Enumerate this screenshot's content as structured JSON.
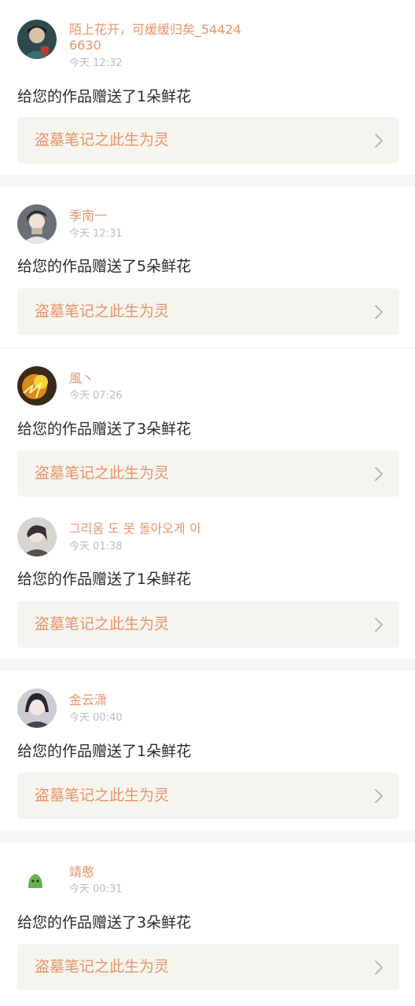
{
  "notifications": [
    {
      "avatar_icon": "avatar-photo-icon",
      "username": "陌上花开，可缓缓归矣_544246630",
      "time": "今天 12:32",
      "message": "给您的作品赠送了1朵鲜花",
      "work_title": "盗墓笔记之此生为灵"
    },
    {
      "avatar_icon": "avatar-photo-icon",
      "username": "季南一",
      "time": "今天 12:31",
      "message": "给您的作品赠送了5朵鲜花",
      "work_title": "盗墓笔记之此生为灵"
    },
    {
      "avatar_icon": "avatar-photo-icon",
      "username": "風丶",
      "time": "今天 07:26",
      "message": "给您的作品赠送了3朵鲜花",
      "work_title": "盗墓笔记之此生为灵"
    },
    {
      "avatar_icon": "avatar-photo-icon",
      "username": "그리움 도 못 돌아오게 이",
      "time": "今天 01:38",
      "message": "给您的作品赠送了1朵鲜花",
      "work_title": "盗墓笔记之此生为灵"
    },
    {
      "avatar_icon": "avatar-photo-icon",
      "username": "金云潇",
      "time": "今天 00:40",
      "message": "给您的作品赠送了1朵鲜花",
      "work_title": "盗墓笔记之此生为灵"
    },
    {
      "avatar_icon": "green-blob-avatar-icon",
      "username": "靖憨",
      "time": "今天 00:31",
      "message": "给您的作品赠送了3朵鲜花",
      "work_title": "盗墓笔记之此生为灵"
    }
  ],
  "colors": {
    "username": "#e8946a",
    "work_title": "#e8946a",
    "time": "#bdbdbd",
    "message": "#2b2b2b",
    "link_background": "#f6f4ee",
    "page_background": "#f7f7f7"
  }
}
